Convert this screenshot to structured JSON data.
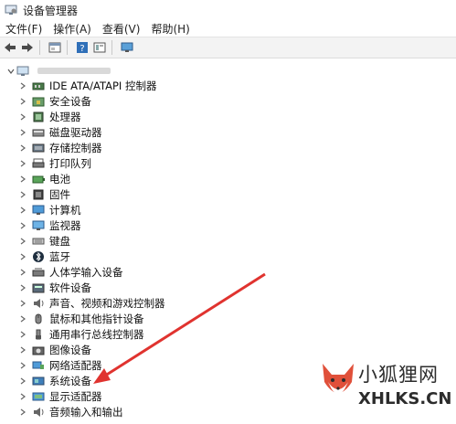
{
  "window": {
    "title": "设备管理器"
  },
  "menu": [
    "文件(F)",
    "操作(A)",
    "查看(V)",
    "帮助(H)"
  ],
  "toolbar": [
    "back-icon",
    "forward-icon",
    "properties-icon",
    "help-icon",
    "view-icon",
    "monitor-icon"
  ],
  "tree": {
    "items": [
      {
        "label": "IDE ATA/ATAPI 控制器",
        "icon": "ide-controller-icon"
      },
      {
        "label": "安全设备",
        "icon": "security-device-icon"
      },
      {
        "label": "处理器",
        "icon": "processor-icon"
      },
      {
        "label": "磁盘驱动器",
        "icon": "disk-drive-icon"
      },
      {
        "label": "存储控制器",
        "icon": "storage-controller-icon"
      },
      {
        "label": "打印队列",
        "icon": "printer-icon"
      },
      {
        "label": "电池",
        "icon": "battery-icon"
      },
      {
        "label": "固件",
        "icon": "firmware-icon"
      },
      {
        "label": "计算机",
        "icon": "computer-icon"
      },
      {
        "label": "监视器",
        "icon": "monitor-icon"
      },
      {
        "label": "键盘",
        "icon": "keyboard-icon"
      },
      {
        "label": "蓝牙",
        "icon": "bluetooth-icon"
      },
      {
        "label": "人体学输入设备",
        "icon": "hid-icon"
      },
      {
        "label": "软件设备",
        "icon": "software-device-icon"
      },
      {
        "label": "声音、视频和游戏控制器",
        "icon": "audio-icon"
      },
      {
        "label": "鼠标和其他指针设备",
        "icon": "mouse-icon"
      },
      {
        "label": "通用串行总线控制器",
        "icon": "usb-icon"
      },
      {
        "label": "图像设备",
        "icon": "camera-icon"
      },
      {
        "label": "网络适配器",
        "icon": "network-icon"
      },
      {
        "label": "系统设备",
        "icon": "system-device-icon"
      },
      {
        "label": "显示适配器",
        "icon": "display-adapter-icon"
      },
      {
        "label": "音频输入和输出",
        "icon": "audio-io-icon"
      }
    ]
  },
  "watermark": {
    "title": "小狐狸网",
    "subtitle": "XHLKS.CN"
  },
  "colors": {
    "arrow": "#e0332f",
    "selection": "#e4ecf7",
    "toolbar": "#f3f3f3"
  }
}
